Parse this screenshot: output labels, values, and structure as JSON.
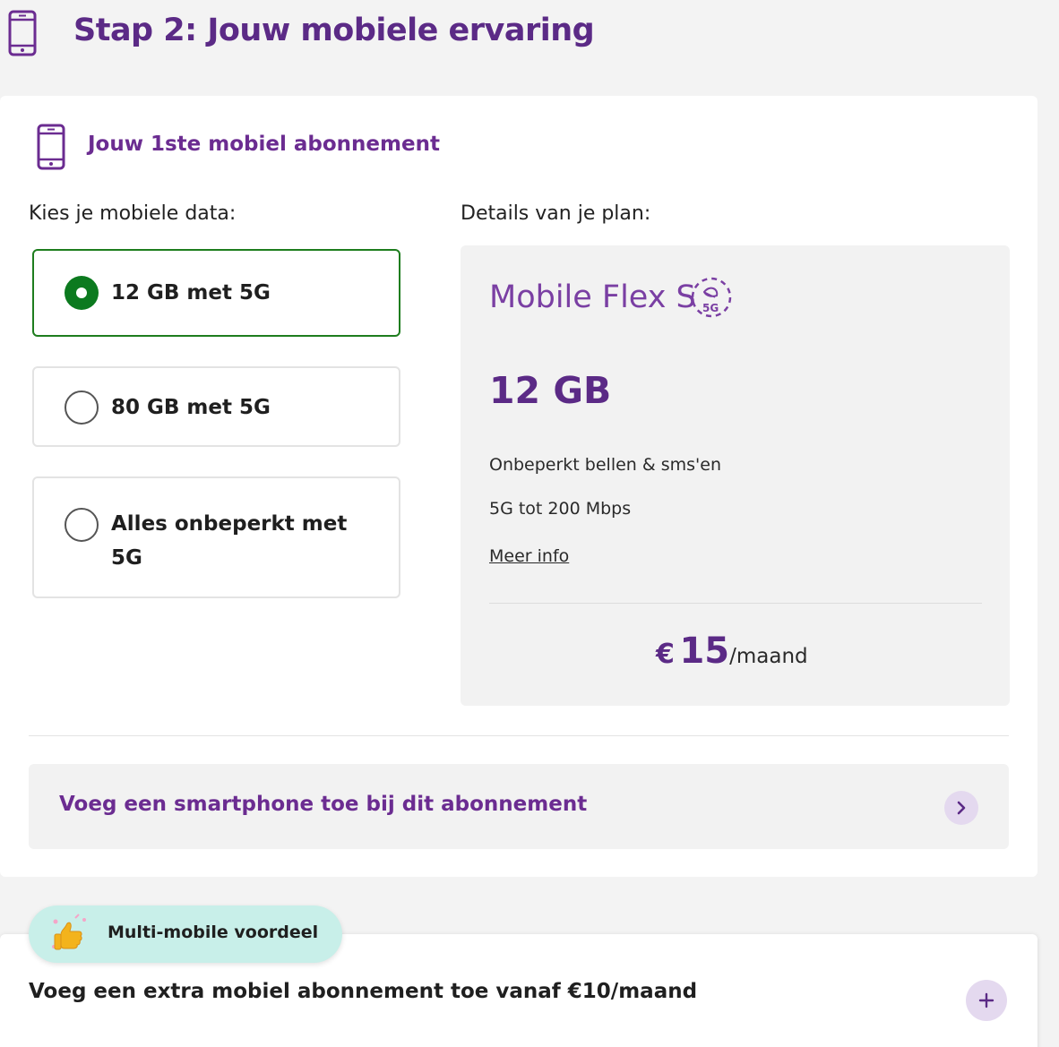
{
  "step": {
    "title": "Stap 2: Jouw mobiele ervaring"
  },
  "subscription": {
    "title": "Jouw 1ste mobiel abonnement"
  },
  "data_choice": {
    "label": "Kies je mobiele data:",
    "options": [
      {
        "label": "12 GB met 5G",
        "selected": true
      },
      {
        "label": "80 GB met 5G",
        "selected": false
      },
      {
        "label": "Alles onbeperkt met 5G",
        "selected": false
      }
    ]
  },
  "details": {
    "label": "Details van je plan:",
    "plan_name": "Mobile Flex S",
    "badge": "5G",
    "data_amount": "12 GB",
    "features": [
      "Onbeperkt bellen & sms'en",
      "5G tot 200 Mbps"
    ],
    "more_info": "Meer info",
    "price_currency": "€",
    "price_amount": "15",
    "price_period": "/maand"
  },
  "smartphone": {
    "label": "Voeg een smartphone toe bij dit abonnement"
  },
  "multi_mobile": {
    "badge": "Multi-mobile voordeel",
    "label": "Voeg een extra mobiel abonnement toe vanaf €10/maand"
  },
  "colors": {
    "brand_purple": "#5b2a86",
    "selected_green": "#0c7a1f",
    "pill_teal": "#c8efe9"
  }
}
